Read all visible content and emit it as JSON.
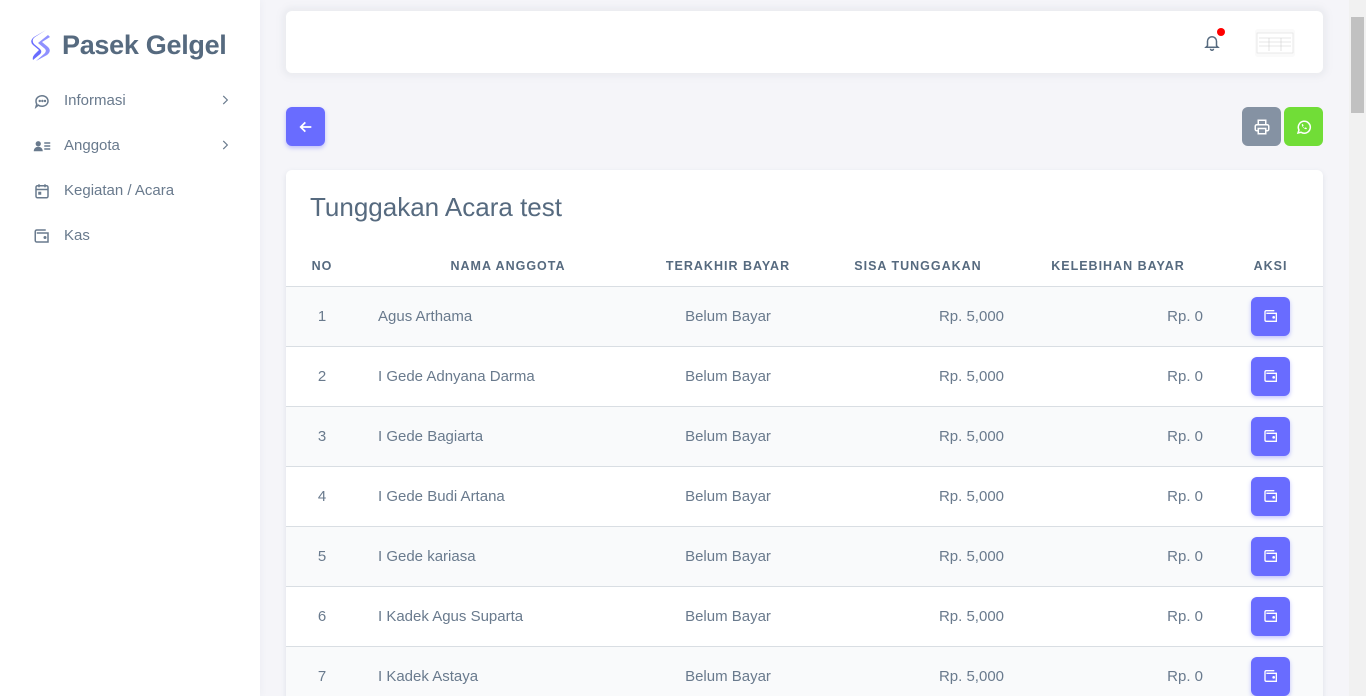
{
  "brand": {
    "name": "Pasek Gelgel",
    "accent": "#696cff"
  },
  "sidebar": {
    "items": [
      {
        "label": "Informasi",
        "icon": "chat-bubble-icon",
        "has_submenu": true
      },
      {
        "label": "Anggota",
        "icon": "user-list-icon",
        "has_submenu": true
      },
      {
        "label": "Kegiatan / Acara",
        "icon": "calendar-icon",
        "has_submenu": false
      },
      {
        "label": "Kas",
        "icon": "wallet-icon",
        "has_submenu": false
      }
    ]
  },
  "navbar": {
    "notification_icon": "bell-icon",
    "has_unread": true
  },
  "actions": {
    "back_icon": "arrow-left-icon",
    "print_icon": "printer-icon",
    "whatsapp_icon": "whatsapp-icon",
    "print_color": "#8592a3",
    "whatsapp_color": "#71dd37"
  },
  "card": {
    "title": "Tunggakan Acara test",
    "columns": [
      "NO",
      "NAMA ANGGOTA",
      "TERAKHIR BAYAR",
      "SISA TUNGGAKAN",
      "KELEBIHAN BAYAR",
      "AKSI"
    ],
    "rows": [
      {
        "no": "1",
        "name": "Agus Arthama",
        "last": "Belum Bayar",
        "sisa": "Rp. 5,000",
        "lebih": "Rp. 0"
      },
      {
        "no": "2",
        "name": "I Gede Adnyana Darma",
        "last": "Belum Bayar",
        "sisa": "Rp. 5,000",
        "lebih": "Rp. 0"
      },
      {
        "no": "3",
        "name": "I Gede Bagiarta",
        "last": "Belum Bayar",
        "sisa": "Rp. 5,000",
        "lebih": "Rp. 0"
      },
      {
        "no": "4",
        "name": "I Gede Budi Artana",
        "last": "Belum Bayar",
        "sisa": "Rp. 5,000",
        "lebih": "Rp. 0"
      },
      {
        "no": "5",
        "name": "I Gede kariasa",
        "last": "Belum Bayar",
        "sisa": "Rp. 5,000",
        "lebih": "Rp. 0"
      },
      {
        "no": "6",
        "name": "I Kadek Agus Suparta",
        "last": "Belum Bayar",
        "sisa": "Rp. 5,000",
        "lebih": "Rp. 0"
      },
      {
        "no": "7",
        "name": "I Kadek Astaya",
        "last": "Belum Bayar",
        "sisa": "Rp. 5,000",
        "lebih": "Rp. 0"
      }
    ],
    "row_action_icon": "wallet-icon"
  }
}
